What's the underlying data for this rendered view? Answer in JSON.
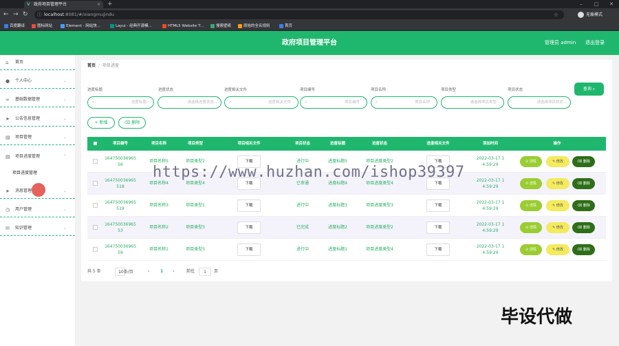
{
  "browser": {
    "tab_title": "政府项目管理平台",
    "url_host": "localhost",
    "url_path": ":8081/#/xiangmujindu",
    "profile_label": "无痕模式",
    "bookmarks": [
      "百度翻译",
      "图标网站",
      "Element - 网站快...",
      "Layui - 经典开源模...",
      "HTML5 Website T...",
      "搜索壁纸",
      "原始的全名规则",
      "首页"
    ]
  },
  "header": {
    "title": "政府项目管理平台",
    "admin": "管理员 admin",
    "logout": "退出登录"
  },
  "sidebar": {
    "items": [
      {
        "label": "首页",
        "icon": "home-icon"
      },
      {
        "label": "个人中心",
        "icon": "user-icon"
      },
      {
        "label": "基础数据管理",
        "icon": "link-icon"
      },
      {
        "label": "公告信息管理",
        "icon": "send-icon"
      },
      {
        "label": "项目管理",
        "icon": "doc-icon"
      },
      {
        "label": "项目进度管理",
        "icon": "doc-icon"
      },
      {
        "label": "消息管理",
        "icon": "send-icon"
      },
      {
        "label": "用户管理",
        "icon": "clock-icon"
      },
      {
        "label": "知识管理",
        "icon": "mail-icon"
      }
    ],
    "sub_item": "项目进度管理"
  },
  "breadcrumb": {
    "home": "首页",
    "sep": "/",
    "current": "项目进度"
  },
  "filters": {
    "labels": [
      "进度标题",
      "进度状态",
      "进度相关文件",
      "项目编号",
      "项目名称",
      "项目类型",
      "项目状态"
    ],
    "placeholders": [
      "进度标题",
      "请选择进度状态",
      "进度相关文件",
      "项目编号",
      "项目名称",
      "请选择项目类型",
      "请选择项目状态"
    ],
    "query": "查询"
  },
  "actions": {
    "add": "+ 新增",
    "delete": "删除"
  },
  "table": {
    "headers": [
      "项目编号",
      "项目名称",
      "项目类型",
      "项目相关文件",
      "项目状态",
      "进度标题",
      "进度状态",
      "进度相关文件",
      "添加时间",
      "操作"
    ],
    "download": "下载",
    "op_review": "详情",
    "op_modify": "修改",
    "op_delete": "删除",
    "rows": [
      {
        "id": [
          "164750036965",
          "56"
        ],
        "name": "项目名称5",
        "type": "项目类型2",
        "status": "进行中",
        "ptitle": "进度标题5",
        "pstatus": "项目进度类型2",
        "time": [
          "2022-03-17 1",
          "4:59:29"
        ]
      },
      {
        "id": [
          "164750036965",
          "518"
        ],
        "name": "项目名称4",
        "type": "项目类型4",
        "status": "已审通",
        "ptitle": "进度标题4",
        "pstatus": "项目进度类型4",
        "time": [
          "2022-03-17 1",
          "4:59:29"
        ]
      },
      {
        "id": [
          "164750036965",
          "519"
        ],
        "name": "项目名称3",
        "type": "项目类型1",
        "status": "进行中",
        "ptitle": "进度标题3",
        "pstatus": "项目进度类型3",
        "time": [
          "2022-03-17 1",
          "4:59:29"
        ]
      },
      {
        "id": [
          "164750036965",
          "53"
        ],
        "name": "项目名称2",
        "type": "项目类型3",
        "status": "已完成",
        "ptitle": "进度标题2",
        "pstatus": "项目进度类型2",
        "time": [
          "2022-03-17 1",
          "4:59:29"
        ]
      },
      {
        "id": [
          "164750036965",
          "59"
        ],
        "name": "项目名称1",
        "type": "项目类型3",
        "status": "进行中",
        "ptitle": "进度标题1",
        "pstatus": "项目进度类型4",
        "time": [
          "2022-03-17 1",
          "4:59:29"
        ]
      }
    ]
  },
  "pager": {
    "total": "共 5 条",
    "size": "10条/页",
    "prev": "‹",
    "page": "1",
    "next": "›",
    "goto": "前往",
    "goto_val": "1",
    "page_unit": "页"
  },
  "overlay": {
    "watermark": "https://www.huzhan.com/ishop39397",
    "stamp": "毕设代做"
  },
  "colors": {
    "primary": "#1fb76e",
    "review": "#9acd32",
    "modify": "#f3ea5d",
    "delete": "#2f6e18"
  }
}
